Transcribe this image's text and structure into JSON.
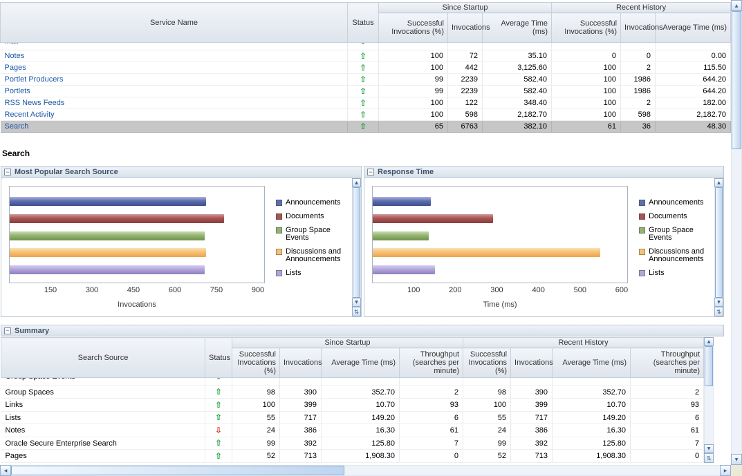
{
  "section_title": "Search",
  "services_table": {
    "headers": {
      "service_name": "Service Name",
      "status": "Status",
      "since_startup": "Since Startup",
      "recent_history": "Recent History",
      "successful_invocations": "Successful Invocations (%)",
      "invocations": "Invocations",
      "average_time": "Average Time (ms)"
    },
    "clipped_row": {
      "name": "Mail",
      "status": "up",
      "selected": false,
      "values": [
        "",
        "",
        "",
        "",
        "",
        ""
      ]
    },
    "rows": [
      {
        "name": "Notes",
        "status": "up",
        "selected": false,
        "values": [
          "100",
          "72",
          "35.10",
          "0",
          "0",
          "0.00"
        ]
      },
      {
        "name": "Pages",
        "status": "up",
        "selected": false,
        "values": [
          "100",
          "442",
          "3,125.60",
          "100",
          "2",
          "115.50"
        ]
      },
      {
        "name": "Portlet Producers",
        "status": "up",
        "selected": false,
        "values": [
          "99",
          "2239",
          "582.40",
          "100",
          "1986",
          "644.20"
        ]
      },
      {
        "name": "Portlets",
        "status": "up",
        "selected": false,
        "values": [
          "99",
          "2239",
          "582.40",
          "100",
          "1986",
          "644.20"
        ]
      },
      {
        "name": "RSS News Feeds",
        "status": "up",
        "selected": false,
        "values": [
          "100",
          "122",
          "348.40",
          "100",
          "2",
          "182.00"
        ]
      },
      {
        "name": "Recent Activity",
        "status": "up",
        "selected": false,
        "values": [
          "100",
          "598",
          "2,182.70",
          "100",
          "598",
          "2,182.70"
        ]
      },
      {
        "name": "Search",
        "status": "up",
        "selected": true,
        "values": [
          "65",
          "6763",
          "382.10",
          "61",
          "36",
          "48.30"
        ]
      }
    ]
  },
  "chart_data": [
    {
      "type": "bar",
      "orientation": "horizontal",
      "title": "Most Popular Search Source",
      "xlabel": "Invocations",
      "xlim": [
        0,
        925
      ],
      "xmax": 925,
      "ticks": [
        150,
        300,
        450,
        600,
        750,
        900
      ],
      "grid": false,
      "legend_position": "right",
      "categories": [
        "Announcements",
        "Documents",
        "Group Space Events",
        "Discussions and Announcements",
        "Lists"
      ],
      "values": [
        715,
        780,
        710,
        715,
        710
      ]
    },
    {
      "type": "bar",
      "orientation": "horizontal",
      "title": "Response Time",
      "xlabel": "Time (ms)",
      "xlim": [
        0,
        615
      ],
      "xmax": 615,
      "ticks": [
        100,
        200,
        300,
        400,
        500,
        600
      ],
      "grid": false,
      "legend_position": "right",
      "categories": [
        "Announcements",
        "Documents",
        "Group Space Events",
        "Discussions and Announcements",
        "Lists"
      ],
      "values": [
        140,
        290,
        135,
        550,
        150
      ]
    }
  ],
  "series_colors": [
    {
      "name": "Announcements",
      "swatch": "#5e6fae",
      "grad_top": "#a8b4de",
      "grad_bottom": "#3a4d8e"
    },
    {
      "name": "Documents",
      "swatch": "#a85454",
      "grad_top": "#d49a9a",
      "grad_bottom": "#8a3c3c"
    },
    {
      "name": "Group Space Events",
      "swatch": "#94b473",
      "grad_top": "#c8dcae",
      "grad_bottom": "#6d9449"
    },
    {
      "name": "Discussions and Announcements",
      "swatch": "#f6c175",
      "grad_top": "#fbe2b6",
      "grad_bottom": "#eda34b"
    },
    {
      "name": "Lists",
      "swatch": "#b2a5da",
      "grad_top": "#d8cfef",
      "grad_bottom": "#8f7fc4"
    }
  ],
  "summary": {
    "title": "Summary",
    "headers": {
      "search_source": "Search Source",
      "status": "Status",
      "since_startup": "Since Startup",
      "recent_history": "Recent History",
      "successful_invocations": "Successful Invocations (%)",
      "invocations": "Invocations",
      "average_time": "Average Time (ms)",
      "throughput": "Throughput (searches per minute)"
    },
    "clipped_row": {
      "name": "Group Space Events",
      "status": "up",
      "selected": false,
      "values": [
        "",
        "",
        "",
        "",
        "",
        "",
        "",
        ""
      ]
    },
    "rows": [
      {
        "name": "Group Spaces",
        "status": "up",
        "selected": false,
        "values": [
          "98",
          "390",
          "352.70",
          "2",
          "98",
          "390",
          "352.70",
          "2"
        ]
      },
      {
        "name": "Links",
        "status": "up",
        "selected": false,
        "values": [
          "100",
          "399",
          "10.70",
          "93",
          "100",
          "399",
          "10.70",
          "93"
        ]
      },
      {
        "name": "Lists",
        "status": "up",
        "selected": false,
        "values": [
          "55",
          "717",
          "149.20",
          "6",
          "55",
          "717",
          "149.20",
          "6"
        ]
      },
      {
        "name": "Notes",
        "status": "down",
        "selected": false,
        "values": [
          "24",
          "386",
          "16.30",
          "61",
          "24",
          "386",
          "16.30",
          "61"
        ]
      },
      {
        "name": "Oracle Secure Enterprise Search",
        "status": "up",
        "selected": false,
        "values": [
          "99",
          "392",
          "125.80",
          "7",
          "99",
          "392",
          "125.80",
          "7"
        ]
      },
      {
        "name": "Pages",
        "status": "up",
        "selected": false,
        "values": [
          "52",
          "713",
          "1,908.30",
          "0",
          "52",
          "713",
          "1,908.30",
          "0"
        ]
      }
    ]
  },
  "icons": {
    "collapse": "−",
    "arrow_up": "⇧",
    "arrow_down": "⇩",
    "sb_up": "▲",
    "sb_down": "▼",
    "sb_left": "◀",
    "sb_right": "▶",
    "resize": "⇅"
  }
}
